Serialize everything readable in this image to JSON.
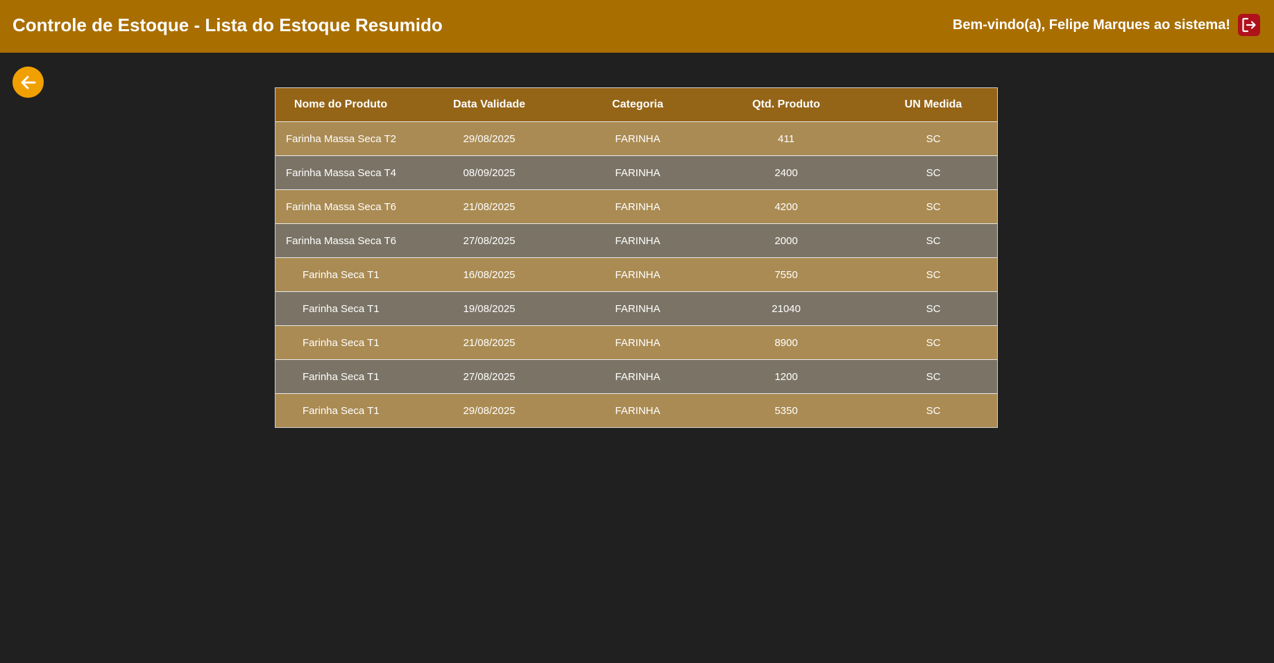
{
  "header": {
    "title": "Controle de Estoque - Lista do Estoque Resumido",
    "welcome": "Bem-vindo(a), Felipe Marques ao sistema!"
  },
  "icons": {
    "back": "arrow-left-icon",
    "logout": "logout-icon"
  },
  "colors": {
    "header_bg": "#a96e00",
    "page_bg": "#202020",
    "table_header_bg": "#946417",
    "row_odd_bg": "#aa8b53",
    "row_even_bg": "#7b7466",
    "back_button": "#f0a000",
    "logout_button": "#b0121c"
  },
  "table": {
    "columns": [
      "Nome do Produto",
      "Data Validade",
      "Categoria",
      "Qtd. Produto",
      "UN Medida"
    ],
    "rows": [
      [
        "Farinha Massa Seca T2",
        "29/08/2025",
        "FARINHA",
        "411",
        "SC"
      ],
      [
        "Farinha Massa Seca T4",
        "08/09/2025",
        "FARINHA",
        "2400",
        "SC"
      ],
      [
        "Farinha Massa Seca T6",
        "21/08/2025",
        "FARINHA",
        "4200",
        "SC"
      ],
      [
        "Farinha Massa Seca T6",
        "27/08/2025",
        "FARINHA",
        "2000",
        "SC"
      ],
      [
        "Farinha Seca T1",
        "16/08/2025",
        "FARINHA",
        "7550",
        "SC"
      ],
      [
        "Farinha Seca T1",
        "19/08/2025",
        "FARINHA",
        "21040",
        "SC"
      ],
      [
        "Farinha Seca T1",
        "21/08/2025",
        "FARINHA",
        "8900",
        "SC"
      ],
      [
        "Farinha Seca T1",
        "27/08/2025",
        "FARINHA",
        "1200",
        "SC"
      ],
      [
        "Farinha Seca T1",
        "29/08/2025",
        "FARINHA",
        "5350",
        "SC"
      ]
    ]
  }
}
